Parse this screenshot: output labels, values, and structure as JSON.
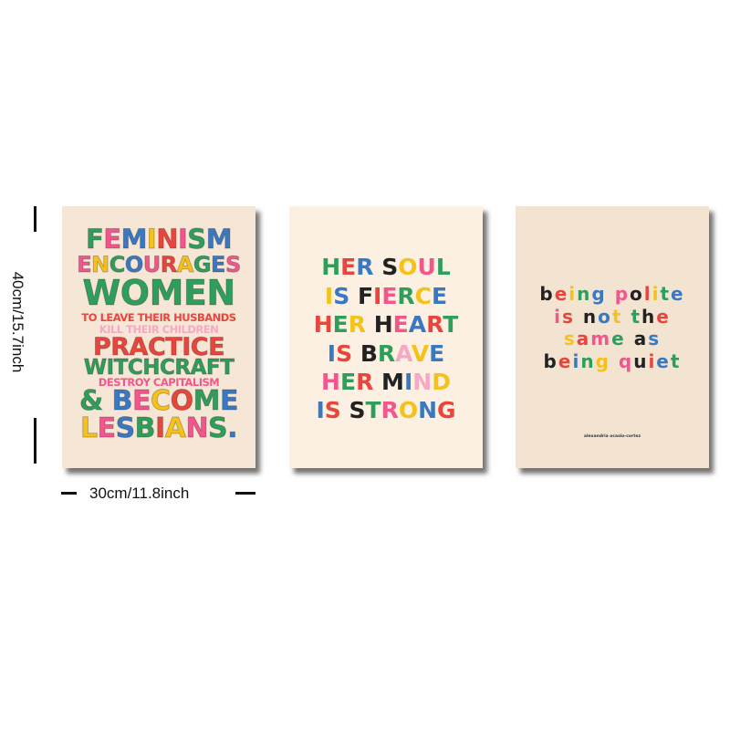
{
  "dimensions": {
    "height_label": "40cm/15.7inch",
    "width_label": "30cm/11.8inch"
  },
  "posters": [
    {
      "lines": [
        "FEMINISM",
        "ENCOURAGES",
        "WOMEN",
        "TO LEAVE THEIR HUSBANDS",
        "KILL THEIR CHILDREN",
        "PRACTICE",
        "WITCHCRAFT",
        "DESTROY CAPITALISM",
        "& BECOME",
        "LESBIANS."
      ]
    },
    {
      "lines": [
        "HER SOUL",
        "IS FIERCE",
        "HER HEART",
        "IS BRAVE",
        "HER MIND",
        "IS STRONG"
      ]
    },
    {
      "lines": [
        "being polite",
        "is not the",
        "same as",
        "being quiet"
      ],
      "author": "alexandria ocasio-cortez"
    }
  ],
  "palette": [
    "#2f9e5b",
    "#f2568c",
    "#3a78c2",
    "#f5c21b",
    "#e8463d",
    "#f7a8c4",
    "#2a9d8f",
    "#222222"
  ]
}
